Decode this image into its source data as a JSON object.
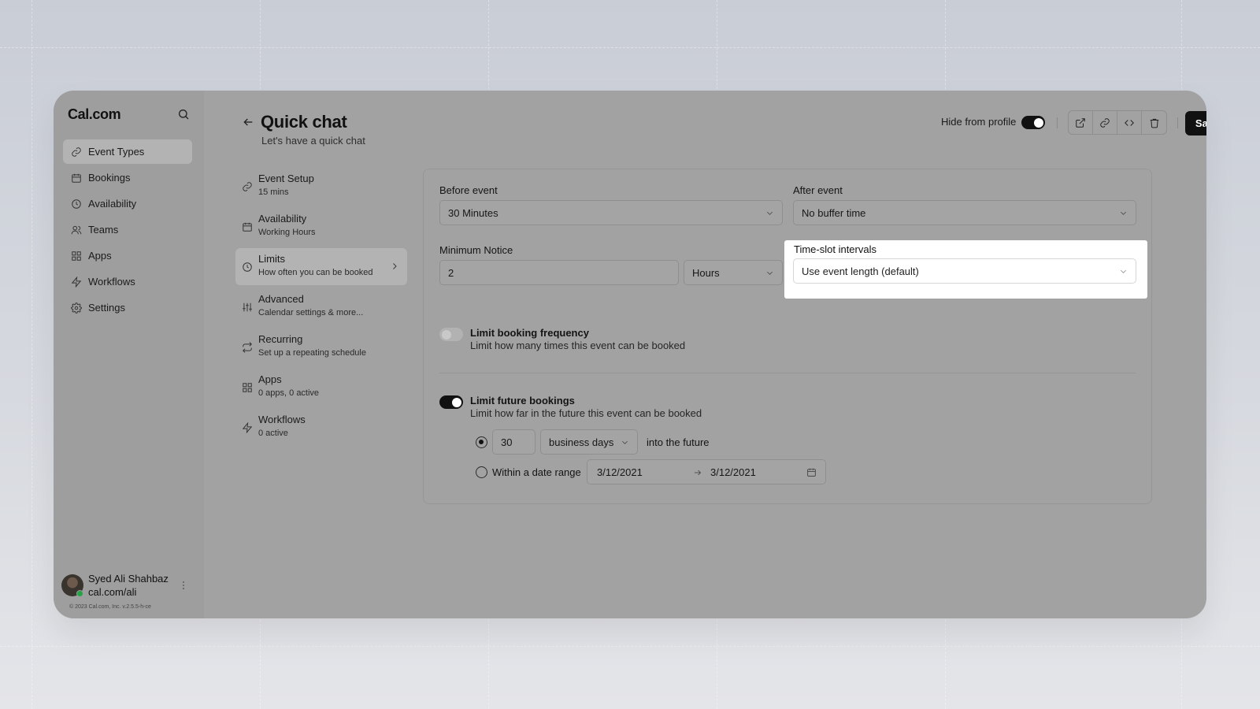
{
  "brand": "Cal.com",
  "sidebar": {
    "items": [
      {
        "label": "Event Types",
        "icon": "link-icon"
      },
      {
        "label": "Bookings",
        "icon": "calendar-icon"
      },
      {
        "label": "Availability",
        "icon": "clock-icon"
      },
      {
        "label": "Teams",
        "icon": "users-icon"
      },
      {
        "label": "Apps",
        "icon": "grid-icon"
      },
      {
        "label": "Workflows",
        "icon": "zap-icon"
      },
      {
        "label": "Settings",
        "icon": "gear-icon"
      }
    ],
    "active_index": 0
  },
  "user": {
    "name": "Syed Ali Shahbaz",
    "link": "cal.com/ali",
    "status": "online"
  },
  "copyright": "© 2023 Cal.com, Inc. v.2.5.5-h-ce",
  "header": {
    "title": "Quick chat",
    "subtitle": "Let's have a quick chat",
    "hide_label": "Hide from profile",
    "hide_enabled": true,
    "save_label": "Save"
  },
  "subnav": {
    "items": [
      {
        "title": "Event Setup",
        "desc": "15 mins"
      },
      {
        "title": "Availability",
        "desc": "Working Hours"
      },
      {
        "title": "Limits",
        "desc": "How often you can be booked"
      },
      {
        "title": "Advanced",
        "desc": "Calendar settings & more..."
      },
      {
        "title": "Recurring",
        "desc": "Set up a repeating schedule"
      },
      {
        "title": "Apps",
        "desc": "0 apps, 0 active"
      },
      {
        "title": "Workflows",
        "desc": "0 active"
      }
    ],
    "active_index": 2
  },
  "limits": {
    "before_event": {
      "label": "Before event",
      "value": "30 Minutes"
    },
    "after_event": {
      "label": "After event",
      "value": "No buffer time"
    },
    "minimum_notice": {
      "label": "Minimum Notice",
      "value": "2",
      "unit": "Hours"
    },
    "time_slot": {
      "label": "Time-slot intervals",
      "value": "Use event length (default)"
    },
    "frequency": {
      "title": "Limit booking frequency",
      "desc": "Limit how many times this event can be booked",
      "enabled": false
    },
    "future": {
      "title": "Limit future bookings",
      "desc": "Limit how far in the future this event can be booked",
      "enabled": true,
      "days_value": "30",
      "days_unit": "business days",
      "days_suffix": "into the future",
      "range_label": "Within a date range",
      "range_start": "3/12/2021",
      "range_end": "3/12/2021"
    }
  },
  "colors": {
    "accent": "#111111",
    "highlight": "#ffffff",
    "online": "#22a344"
  }
}
